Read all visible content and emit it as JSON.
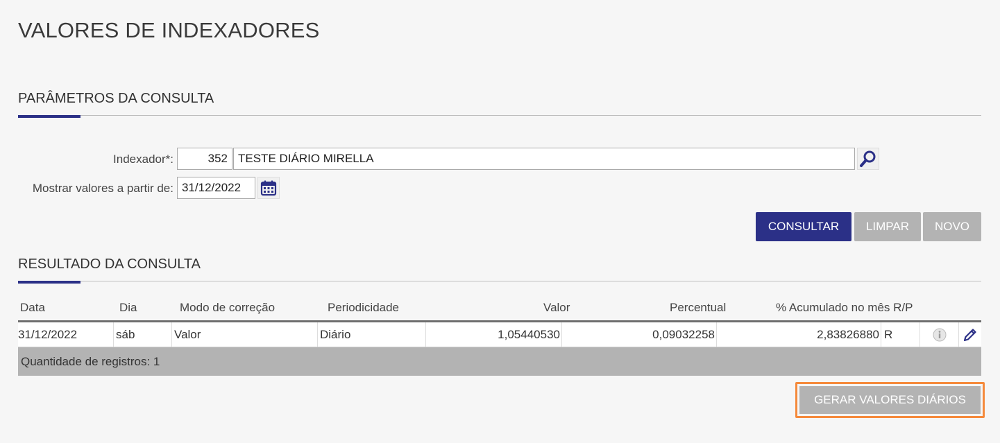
{
  "page": {
    "title": "VALORES DE INDEXADORES"
  },
  "params": {
    "section_title": "PARÂMETROS DA CONSULTA",
    "indexador_label": "Indexador*:",
    "indexador_code": "352",
    "indexador_name": "TESTE DIÁRIO MIRELLA",
    "date_label": "Mostrar valores a partir de:",
    "date_value": "31/12/2022"
  },
  "actions": {
    "consultar": "CONSULTAR",
    "limpar": "LIMPAR",
    "novo": "NOVO"
  },
  "results": {
    "section_title": "RESULTADO DA CONSULTA",
    "columns": {
      "data": "Data",
      "dia": "Dia",
      "modo": "Modo de correção",
      "periodicidade": "Periodicidade",
      "valor": "Valor",
      "percentual": "Percentual",
      "acumulado": "% Acumulado no mês R/P"
    },
    "rows": [
      {
        "data": "31/12/2022",
        "dia": "sáb",
        "modo": "Valor",
        "periodicidade": "Diário",
        "valor": "1,05440530",
        "percentual": "0,09032258",
        "acumulado": "2,83826880",
        "rp": "R"
      }
    ],
    "count_text": "Quantidade de registros: 1"
  },
  "generate_button": "GERAR VALORES DIÁRIOS",
  "colors": {
    "primary": "#2b3087",
    "disabled": "#b3b3b3",
    "highlight": "#f58a3c"
  },
  "icons": {
    "search": "search-icon",
    "calendar": "calendar-icon",
    "info": "info-icon",
    "edit": "edit-pencil-icon"
  }
}
